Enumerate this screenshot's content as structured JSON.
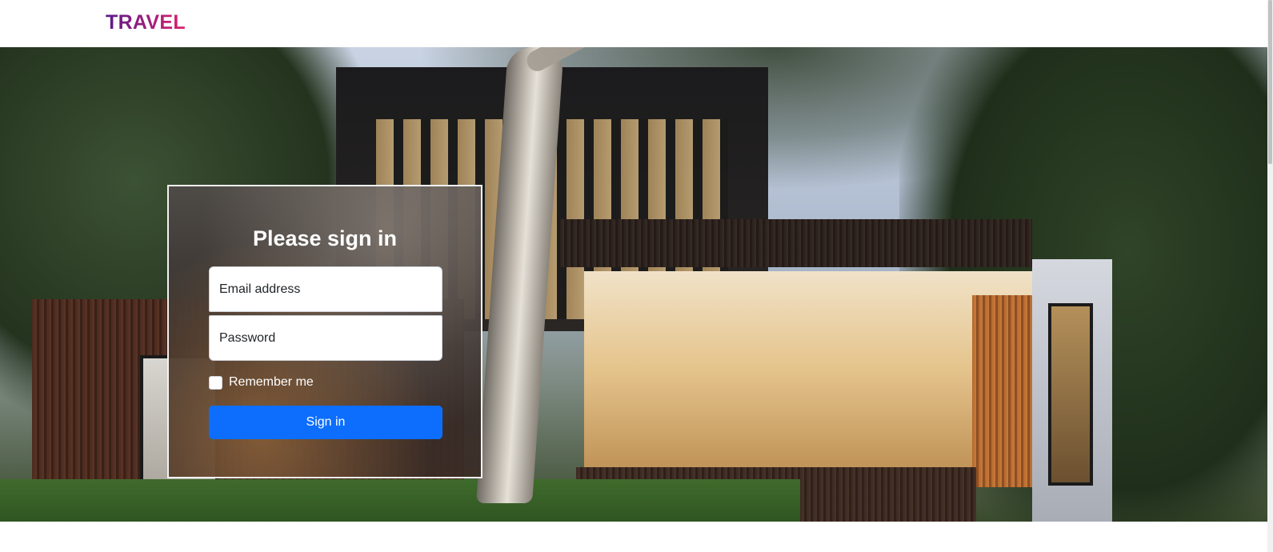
{
  "navbar": {
    "brand": "TRAVEL"
  },
  "hero": {
    "image": "modern-house-photo"
  },
  "signin": {
    "title": "Please sign in",
    "email_placeholder": "Email address",
    "email_value": "",
    "password_placeholder": "Password",
    "password_value": "",
    "remember_label": "Remember me",
    "remember_checked": false,
    "submit_label": "Sign in"
  },
  "colors": {
    "primary_button": "#0d6efd",
    "brand_gradient_start": "#5a1a8a",
    "brand_gradient_end": "#e0206a"
  }
}
